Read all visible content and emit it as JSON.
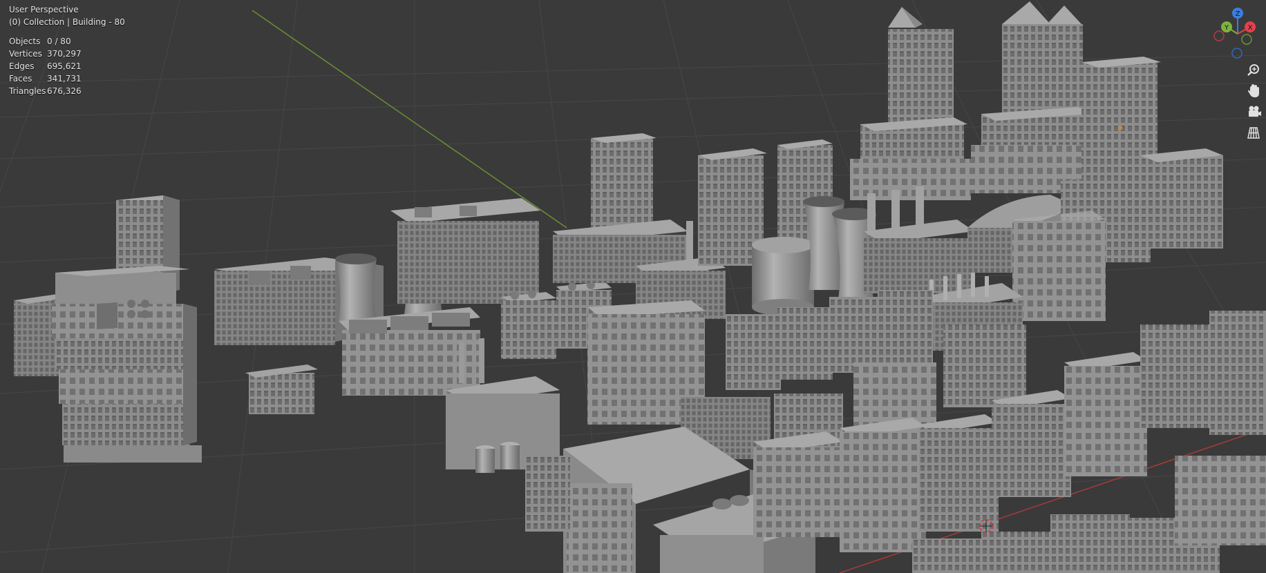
{
  "viewport": {
    "perspective": "User Perspective",
    "collection": "(0) Collection | Building - 80"
  },
  "stats": [
    {
      "label": "Objects",
      "value": "0 / 80"
    },
    {
      "label": "Vertices",
      "value": "370,297"
    },
    {
      "label": "Edges",
      "value": "695,621"
    },
    {
      "label": "Faces",
      "value": "341,731"
    },
    {
      "label": "Triangles",
      "value": "676,326"
    }
  ],
  "gizmo": {
    "axes": [
      "Z",
      "Y",
      "X"
    ],
    "colors": {
      "x": "#e5404e",
      "y": "#7fb33d",
      "z": "#3a7ee0"
    }
  },
  "nav_tools": [
    "zoom-icon",
    "pan-hand-icon",
    "camera-icon",
    "grid-ortho-icon"
  ],
  "colors": {
    "background": "#3a3a3a",
    "grid": "#454545",
    "building": "#8f8f8f",
    "building_dark": "#6a6a6a",
    "building_light": "#a6a6a6"
  }
}
